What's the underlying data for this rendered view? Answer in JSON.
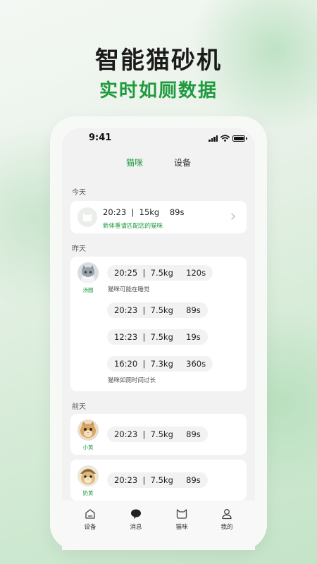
{
  "promo": {
    "headline": "智能猫砂机",
    "subline": "实时如厕数据"
  },
  "status_bar": {
    "time": "9:41",
    "icons": [
      "signal-icon",
      "wifi-icon",
      "battery-icon"
    ]
  },
  "tabs": [
    {
      "label": "猫咪",
      "active": true
    },
    {
      "label": "设备",
      "active": false
    }
  ],
  "sections": {
    "today": {
      "label": "今天",
      "record": "20:23  |  15kg    89s",
      "note": "新体重请匹配您的猫咪"
    },
    "yesterday": {
      "label": "昨天",
      "cat_name": "汤圆",
      "records": [
        {
          "text": "20:25  |  7.5kg     120s",
          "note": "猫咪可能在睡觉"
        },
        {
          "text": "20:23  |  7.5kg     89s",
          "note": ""
        },
        {
          "text": "12:23  |  7.5kg     19s",
          "note": ""
        },
        {
          "text": "16:20  |  7.3kg     360s",
          "note": "猫咪如厕时间过长"
        }
      ]
    },
    "day_before": {
      "label": "前天",
      "entries": [
        {
          "cat_name": "小黄",
          "record": "20:23  |  7.5kg     89s"
        },
        {
          "cat_name": "奶黄",
          "record": "20:23  |  7.5kg     89s"
        }
      ]
    }
  },
  "bottom_nav": [
    {
      "label": "设备",
      "icon": "home-icon"
    },
    {
      "label": "消息",
      "icon": "chat-bubble-icon"
    },
    {
      "label": "猫咪",
      "icon": "cat-icon"
    },
    {
      "label": "我的",
      "icon": "person-icon"
    }
  ],
  "colors": {
    "accent": "#1f9a3e",
    "card": "#ffffff",
    "screen_bg": "#f1f2f1"
  }
}
